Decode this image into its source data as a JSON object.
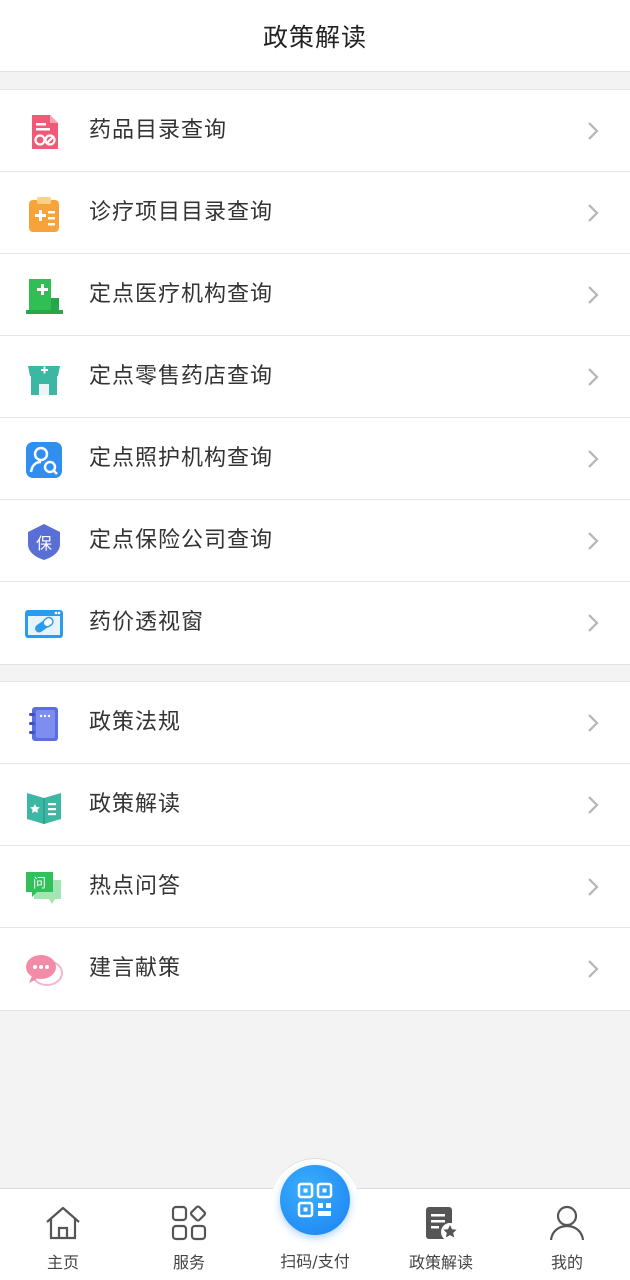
{
  "header": {
    "title": "政策解读"
  },
  "group1": [
    {
      "label": "药品目录查询",
      "icon": "drug-catalog-icon",
      "color": "#ef5b77"
    },
    {
      "label": "诊疗项目目录查询",
      "icon": "treatment-catalog-icon",
      "color": "#f6a33a"
    },
    {
      "label": "定点医疗机构查询",
      "icon": "hospital-icon",
      "color": "#2fbf55"
    },
    {
      "label": "定点零售药店查询",
      "icon": "pharmacy-icon",
      "color": "#3bb7a3"
    },
    {
      "label": "定点照护机构查询",
      "icon": "care-search-icon",
      "color": "#2f8ef0"
    },
    {
      "label": "定点保险公司查询",
      "icon": "insurance-shield-icon",
      "color": "#5a6fd6"
    },
    {
      "label": "药价透视窗",
      "icon": "drug-price-window-icon",
      "color": "#2a9cf0"
    }
  ],
  "group2": [
    {
      "label": "政策法规",
      "icon": "policy-book-icon",
      "color": "#5b6ee0"
    },
    {
      "label": "政策解读",
      "icon": "policy-read-icon",
      "color": "#3bb7a3"
    },
    {
      "label": "热点问答",
      "icon": "qa-chat-icon",
      "color": "#32c05a"
    },
    {
      "label": "建言献策",
      "icon": "suggestion-bubble-icon",
      "color": "#f28ba8"
    }
  ],
  "group2_icon_text": {
    "qa": "问"
  },
  "insurance_icon_text": "保",
  "tabbar": {
    "home": "主页",
    "services": "服务",
    "scan": "扫码/支付",
    "policy": "政策解读",
    "mine": "我的"
  }
}
